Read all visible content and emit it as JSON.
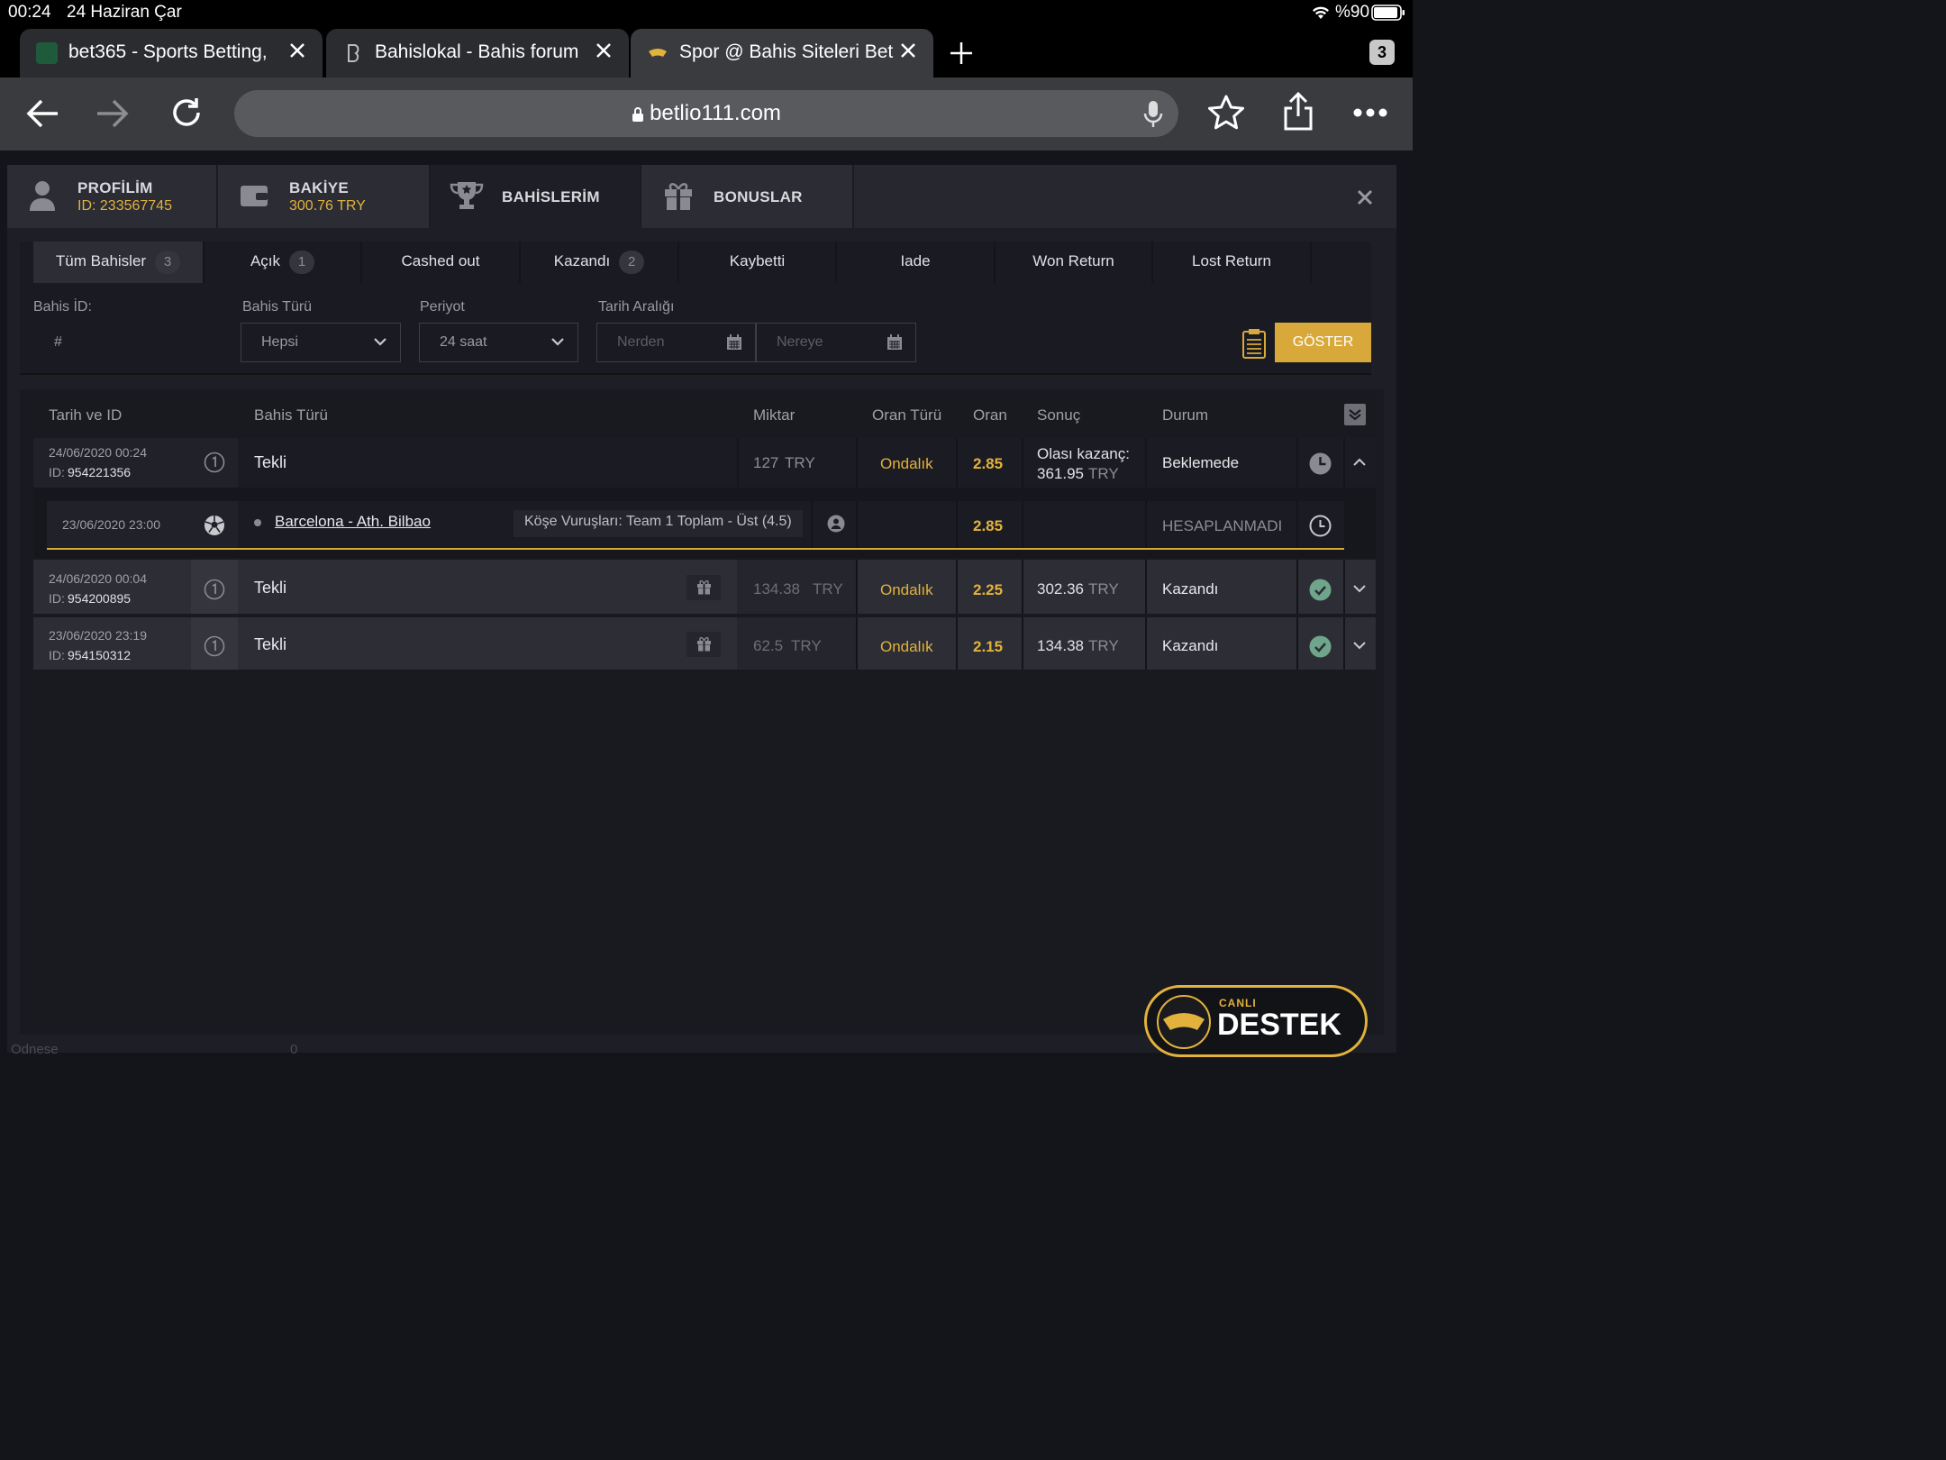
{
  "status_bar": {
    "time": "00:24",
    "date": "24 Haziran Çar",
    "battery": "%90"
  },
  "browser": {
    "tabs": [
      {
        "title": "bet365 - Sports Betting,",
        "favicon": "bet365-icon"
      },
      {
        "title": "Bahislokal - Bahis forum",
        "favicon": "bahislokal-icon"
      },
      {
        "title": "Spor @ Bahis Siteleri Bet",
        "favicon": "betlio-icon"
      }
    ],
    "tab_count": "3",
    "url": "betlio111.com"
  },
  "nav": {
    "profile": {
      "label": "PROFİLİM",
      "sub": "ID: 233567745"
    },
    "balance": {
      "label": "BAKİYE",
      "sub": "300.76 TRY"
    },
    "bets": {
      "label": "BAHİSLERİM"
    },
    "bonuses": {
      "label": "BONUSLAR"
    }
  },
  "filter_tabs": [
    {
      "label": "Tüm Bahisler",
      "count": "3"
    },
    {
      "label": "Açık",
      "count": "1"
    },
    {
      "label": "Cashed out",
      "count": ""
    },
    {
      "label": "Kazandı",
      "count": "2"
    },
    {
      "label": "Kaybetti",
      "count": ""
    },
    {
      "label": "Iade",
      "count": ""
    },
    {
      "label": "Won Return",
      "count": ""
    },
    {
      "label": "Lost Return",
      "count": ""
    }
  ],
  "filters": {
    "bet_id_label": "Bahis İD:",
    "bet_id_placeholder": "#",
    "bet_type_label": "Bahis Türü",
    "bet_type_value": "Hepsi",
    "period_label": "Periyot",
    "period_value": "24 saat",
    "date_range_label": "Tarih Aralığı",
    "from_placeholder": "Nerden",
    "to_placeholder": "Nereye",
    "show_button": "GÖSTER"
  },
  "table": {
    "headers": {
      "date_id": "Tarih ve ID",
      "bet_type": "Bahis Türü",
      "amount": "Miktar",
      "odds_type": "Oran Türü",
      "odds": "Oran",
      "result": "Sonuç",
      "status": "Durum"
    },
    "rows": [
      {
        "date": "24/06/2020 00:24",
        "id_prefix": "ID:",
        "id": "954221356",
        "type": "Tekli",
        "amount": "127",
        "currency": "TRY",
        "odds_type": "Ondalık",
        "odds": "2.85",
        "result_label": "Olası kazanç:",
        "result": "361.95",
        "result_currency": "TRY",
        "status": "Beklemede"
      },
      {
        "date": "24/06/2020 00:04",
        "id_prefix": "ID:",
        "id": "954200895",
        "type": "Tekli",
        "amount": "134.38",
        "currency": "TRY",
        "odds_type": "Ondalık",
        "odds": "2.25",
        "result": "302.36",
        "result_currency": "TRY",
        "status": "Kazandı"
      },
      {
        "date": "23/06/2020 23:19",
        "id_prefix": "ID:",
        "id": "954150312",
        "type": "Tekli",
        "amount": "62.5",
        "currency": "TRY",
        "odds_type": "Ondalık",
        "odds": "2.15",
        "result": "134.38",
        "result_currency": "TRY",
        "status": "Kazandı"
      }
    ],
    "detail": {
      "date": "23/06/2020 23:00",
      "match": "Barcelona - Ath. Bilbao",
      "market": "Köşe Vuruşları: Team 1 Toplam - Üst (4.5)",
      "odds": "2.85",
      "status": "HESAPLANMADI"
    }
  },
  "support": {
    "small": "CANLI",
    "big": "DESTEK"
  },
  "footer": {
    "partial_text": "Odnese",
    "partial_value": "0"
  },
  "colors": {
    "accent": "#e3b23c",
    "bg": "#1e1f26"
  }
}
